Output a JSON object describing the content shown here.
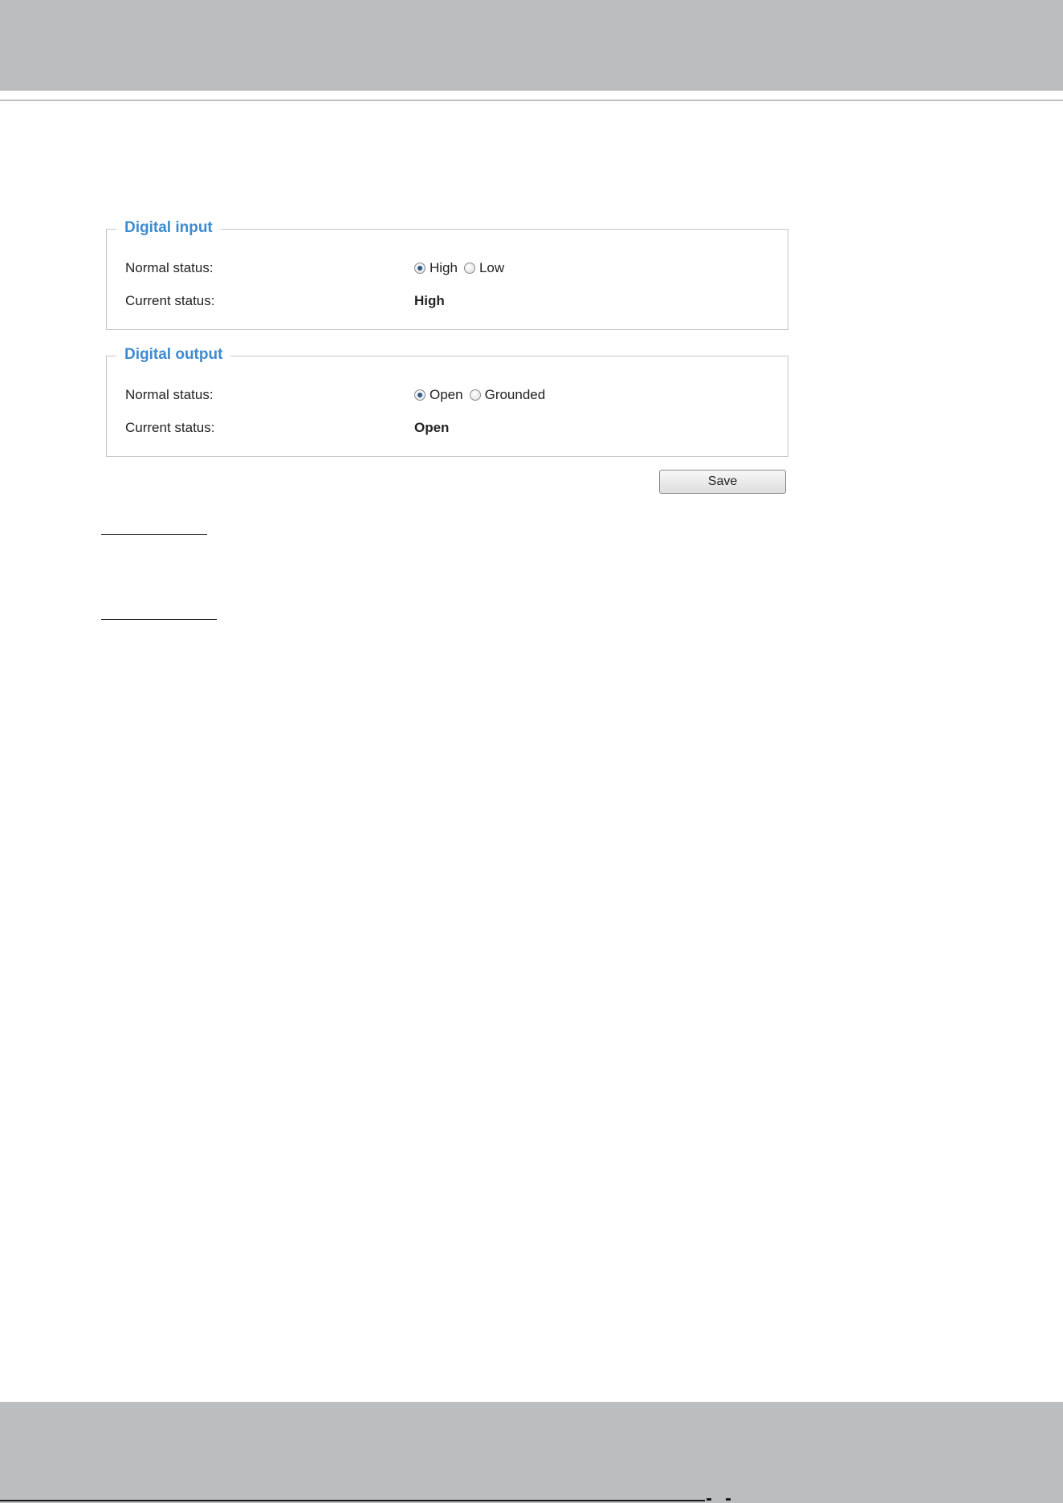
{
  "digital_input": {
    "title": "Digital input",
    "normal_status_label": "Normal status:",
    "options": [
      {
        "label": "High",
        "checked": true
      },
      {
        "label": "Low",
        "checked": false
      }
    ],
    "current_status_label": "Current status:",
    "current_status_value": "High"
  },
  "digital_output": {
    "title": "Digital output",
    "normal_status_label": "Normal status:",
    "options": [
      {
        "label": "Open",
        "checked": true
      },
      {
        "label": "Grounded",
        "checked": false
      }
    ],
    "current_status_label": "Current status:",
    "current_status_value": "Open"
  },
  "actions": {
    "save_label": "Save"
  },
  "colors": {
    "legend_blue": "#3d8bd0",
    "band_gray": "#bcbdbf",
    "panel_border": "#c6c6c6"
  }
}
